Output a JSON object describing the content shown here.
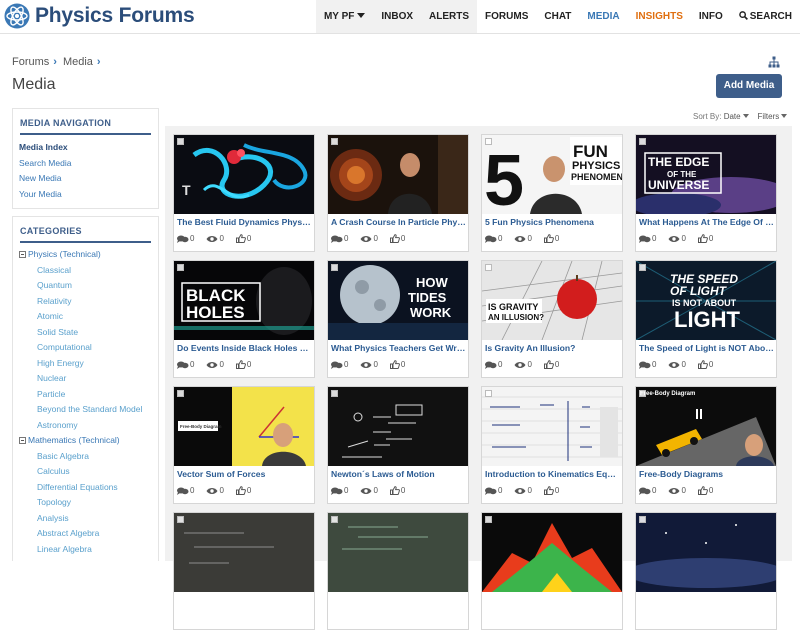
{
  "header": {
    "logo_text": "Physics Forums",
    "nav": [
      {
        "key": "mypf",
        "label": "MY PF"
      },
      {
        "key": "inbox",
        "label": "INBOX"
      },
      {
        "key": "alerts",
        "label": "ALERTS"
      },
      {
        "key": "forums",
        "label": "FORUMS"
      },
      {
        "key": "chat",
        "label": "CHAT"
      },
      {
        "key": "media",
        "label": "MEDIA"
      },
      {
        "key": "insights",
        "label": "INSIGHTS"
      },
      {
        "key": "info",
        "label": "INFO"
      },
      {
        "key": "search",
        "label": "SEARCH"
      }
    ]
  },
  "breadcrumb": [
    "Forums",
    "Media"
  ],
  "page_title": "Media",
  "add_media_label": "Add Media",
  "sort": {
    "prefix": "Sort By:",
    "value": "Date",
    "filters": "Filters"
  },
  "media_navigation": {
    "heading": "MEDIA NAVIGATION",
    "links": [
      "Media Index",
      "Search Media",
      "New Media",
      "Your Media"
    ]
  },
  "categories": {
    "heading": "CATEGORIES",
    "items": [
      {
        "label": "Physics (Technical)",
        "group": true
      },
      {
        "label": "Classical"
      },
      {
        "label": "Quantum"
      },
      {
        "label": "Relativity"
      },
      {
        "label": "Atomic"
      },
      {
        "label": "Solid State"
      },
      {
        "label": "Computational"
      },
      {
        "label": "High Energy"
      },
      {
        "label": "Nuclear"
      },
      {
        "label": "Particle"
      },
      {
        "label": "Beyond the Standard Model"
      },
      {
        "label": "Astronomy"
      },
      {
        "label": "Mathematics (Technical)",
        "group": true
      },
      {
        "label": "Basic Algebra"
      },
      {
        "label": "Calculus"
      },
      {
        "label": "Differential Equations"
      },
      {
        "label": "Topology"
      },
      {
        "label": "Analysis"
      },
      {
        "label": "Abstract Algebra"
      },
      {
        "label": "Linear Algebra"
      }
    ]
  },
  "thumb_text": {
    "five": "5",
    "fun_lines": [
      "FUN",
      "PHYSICS",
      "PHENOMENA"
    ],
    "edge_lines": [
      "THE EDGE",
      "OF THE",
      "UNIVERSE"
    ],
    "black_lines": [
      "BLACK",
      "HOLES"
    ],
    "tides_lines": [
      "HOW",
      "TIDES",
      "WORK"
    ],
    "gravity_lines": [
      "IS GRAVITY",
      "AN ILLUSION?"
    ],
    "light_lines": [
      "THE SPEED",
      "OF LIGHT",
      "IS NOT ABOUT",
      "LIGHT"
    ],
    "fbd_label": "Free-Body Diagram",
    "fbd_small": "Free-Body Diagram"
  },
  "cards": [
    {
      "title": "The Best Fluid Dynamics Physic...",
      "comments": "0",
      "views": "0",
      "likes": "0"
    },
    {
      "title": "A Crash Course In Particle Physics",
      "comments": "0",
      "views": "0",
      "likes": "0"
    },
    {
      "title": "5 Fun Physics Phenomena",
      "comments": "0",
      "views": "0",
      "likes": "0"
    },
    {
      "title": "What Happens At The Edge Of T...",
      "comments": "0",
      "views": "0",
      "likes": "0"
    },
    {
      "title": "Do Events Inside Black Holes Ha...",
      "comments": "0",
      "views": "0",
      "likes": "0"
    },
    {
      "title": "What Physics Teachers Get Wro...",
      "comments": "0",
      "views": "0",
      "likes": "0"
    },
    {
      "title": "Is Gravity An Illusion?",
      "comments": "0",
      "views": "0",
      "likes": "0"
    },
    {
      "title": "The Speed of Light is NOT Abou...",
      "comments": "0",
      "views": "0",
      "likes": "0"
    },
    {
      "title": "Vector Sum of Forces",
      "comments": "0",
      "views": "0",
      "likes": "0"
    },
    {
      "title": "Newton´s Laws of Motion",
      "comments": "0",
      "views": "0",
      "likes": "0"
    },
    {
      "title": "Introduction to Kinematics Equa...",
      "comments": "0",
      "views": "0",
      "likes": "0"
    },
    {
      "title": "Free-Body Diagrams",
      "comments": "0",
      "views": "0",
      "likes": "0"
    },
    {
      "title": "",
      "comments": "",
      "views": "",
      "likes": ""
    },
    {
      "title": "",
      "comments": "",
      "views": "",
      "likes": ""
    },
    {
      "title": "",
      "comments": "",
      "views": "",
      "likes": ""
    },
    {
      "title": "",
      "comments": "",
      "views": "",
      "likes": ""
    }
  ],
  "colors": {
    "brand": "#2b4d7a",
    "link": "#3a78b5",
    "insights": "#e06f10",
    "button": "#3e5e8a"
  }
}
